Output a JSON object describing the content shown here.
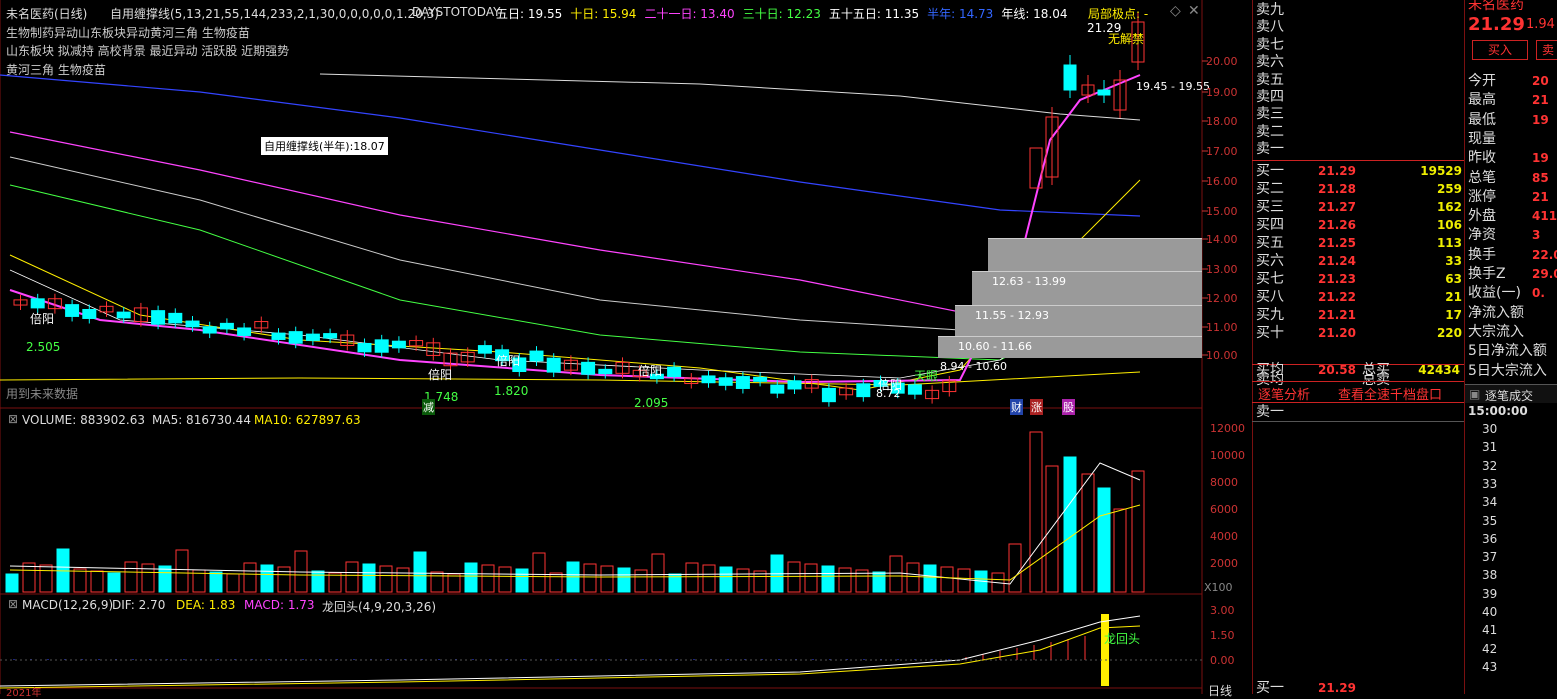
{
  "main_header": {
    "stock": "未名医药(日线)",
    "indicator": "自用缠撑线(5,13,21,55,144,233,2,1,30,0,0,0,0,0,1.20,3)",
    "days": "DAYSTOTODAY",
    "ma": [
      {
        "label": "五日: 19.55",
        "color": "#ffffff"
      },
      {
        "label": "十日: 15.94",
        "color": "#ffee00"
      },
      {
        "label": "二十一日: 13.40",
        "color": "#ff44ff"
      },
      {
        "label": "三十日: 12.23",
        "color": "#44ff44"
      },
      {
        "label": "五十五日: 11.35",
        "color": "#ffffff"
      },
      {
        "label": "半年: 14.73",
        "color": "#3366ff"
      },
      {
        "label": "年线: 18.04",
        "color": "#ffffff"
      }
    ],
    "extra": "局部极点: -"
  },
  "concept_lines": [
    {
      "text": "生物制药异动山东板块异动黄河三角 生物疫苗",
      "color": "#ff4444"
    },
    {
      "text": "山东板块 拟减持 高校背景 最近异动 活跃股 近期强势",
      "color": "#ff44ff"
    },
    {
      "text": "黄河三角 生物疫苗",
      "color": "#ff44ff"
    }
  ],
  "chart_labels": {
    "tooltip": "自用缠撑线(半年):18.07",
    "future_data": "用到未来数据",
    "price_high": "21.29",
    "wujinjie": "无解禁",
    "range_top": "19.45 - 19.55",
    "band1": "12.63 - 13.99",
    "band2": "11.55 - 12.93",
    "band3": "10.60 - 11.66",
    "band4": "8.94 - 10.60",
    "low_price": "8.72",
    "beiyang": "倍阳",
    "jian": "减",
    "tianyan": "天眼",
    "val1": "2.505",
    "val2": "1.748",
    "val3": "1.820",
    "val4": "2.095",
    "cai": "财",
    "zhang": "涨",
    "gu": "股"
  },
  "price_axis": [
    "20.00",
    "19.00",
    "18.00",
    "17.00",
    "16.00",
    "15.00",
    "14.00",
    "13.00",
    "12.00",
    "11.00",
    "10.00"
  ],
  "volume_header": {
    "vol": "VOLUME: 883902.63",
    "ma5": "MA5: 816730.44",
    "ma10": "MA10: 627897.63"
  },
  "volume_axis": [
    "12000",
    "10000",
    "8000",
    "6000",
    "4000",
    "2000"
  ],
  "volume_unit": "X100",
  "macd_header": {
    "macd": "MACD(12,26,9)",
    "dif": "DIF: 2.70",
    "dea": "DEA: 1.83",
    "m": "MACD: 1.73",
    "dragon": "龙回头(4,9,20,3,26)"
  },
  "macd_axis": [
    "3.00",
    "1.50",
    "0.00"
  ],
  "macd_label": "龙回头",
  "date_label": "2021年",
  "order_book": {
    "sell": [
      {
        "side": "卖九",
        "price": "",
        "vol": ""
      },
      {
        "side": "卖八",
        "price": "",
        "vol": ""
      },
      {
        "side": "卖七",
        "price": "",
        "vol": ""
      },
      {
        "side": "卖六",
        "price": "",
        "vol": ""
      },
      {
        "side": "卖五",
        "price": "",
        "vol": ""
      },
      {
        "side": "卖四",
        "price": "",
        "vol": ""
      },
      {
        "side": "卖三",
        "price": "",
        "vol": ""
      },
      {
        "side": "卖二",
        "price": "",
        "vol": ""
      },
      {
        "side": "卖一",
        "price": "",
        "vol": ""
      }
    ],
    "buy": [
      {
        "side": "买一",
        "price": "21.29",
        "vol": "19529"
      },
      {
        "side": "买二",
        "price": "21.28",
        "vol": "259"
      },
      {
        "side": "买三",
        "price": "21.27",
        "vol": "162"
      },
      {
        "side": "买四",
        "price": "21.26",
        "vol": "106"
      },
      {
        "side": "买五",
        "price": "21.25",
        "vol": "113"
      },
      {
        "side": "买六",
        "price": "21.24",
        "vol": "33"
      },
      {
        "side": "买七",
        "price": "21.23",
        "vol": "63"
      },
      {
        "side": "买八",
        "price": "21.22",
        "vol": "21"
      },
      {
        "side": "买九",
        "price": "21.21",
        "vol": "17"
      },
      {
        "side": "买十",
        "price": "21.20",
        "vol": "220"
      }
    ],
    "avg_sell": "卖均",
    "avg_buy": "买均",
    "avg_buy_val": "20.58",
    "total_sell": "总卖",
    "total_buy": "总买",
    "total_buy_val": "42434"
  },
  "bottom_tabs": {
    "left": "逐笔分析",
    "right": "查看全速千档盘口"
  },
  "bottom_sell": "卖一",
  "bottom_row": {
    "side": "买一",
    "price": "21.29"
  },
  "rstats": {
    "top_name": "未名医药",
    "price": "21.29",
    "change": "1.94",
    "buy_btn": "买入",
    "sell_btn": "卖",
    "rows": [
      {
        "k": "今开",
        "v": "20"
      },
      {
        "k": "最高",
        "v": "21"
      },
      {
        "k": "最低",
        "v": "19"
      },
      {
        "k": "现量",
        "v": ""
      },
      {
        "k": "昨收",
        "v": "19"
      },
      {
        "k": "总笔",
        "v": "85"
      },
      {
        "k": "涨停",
        "v": "21"
      },
      {
        "k": "外盘",
        "v": "411"
      },
      {
        "k": "净资",
        "v": "3"
      },
      {
        "k": "换手",
        "v": "22.0"
      },
      {
        "k": "换手Z",
        "v": "29.0"
      },
      {
        "k": "收益(一)",
        "v": "0."
      },
      {
        "k": "净流入额",
        "v": ""
      },
      {
        "k": "大宗流入",
        "v": ""
      },
      {
        "k": "5日净流入额",
        "v": ""
      },
      {
        "k": "5日大宗流入",
        "v": ""
      }
    ],
    "trades_title": "逐笔成交",
    "trades_time": "15:00:00",
    "trades": [
      "30",
      "31",
      "32",
      "33",
      "34",
      "35",
      "36",
      "37",
      "38",
      "39",
      "40",
      "41",
      "42",
      "43"
    ]
  },
  "week_label": "日线",
  "colors": {
    "up": "#ff3333",
    "down": "#00ffff",
    "bg": "#000000",
    "grid": "#7a1010"
  }
}
